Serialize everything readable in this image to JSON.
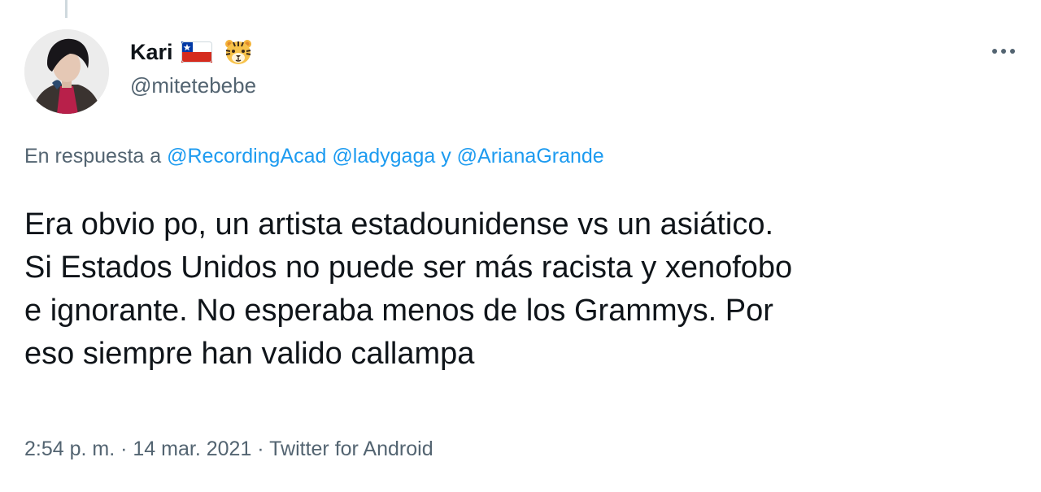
{
  "author": {
    "display_name": "Kari",
    "handle": "@mitetebebe",
    "emoji_icons": [
      "chile-flag-icon",
      "tiger-face-icon"
    ]
  },
  "menu": {
    "more_icon": "more-dots-icon"
  },
  "reply": {
    "prefix": "En respuesta a",
    "mention_1": "@RecordingAcad",
    "mention_2": "@ladygaga",
    "conjunction": "y",
    "mention_3": "@ArianaGrande"
  },
  "tweet": {
    "lines": [
      "Era obvio po, un artista estadounidense vs un asiático.",
      "Si Estados Unidos no puede ser más racista y xenofobo",
      "e ignorante. No esperaba menos de los Grammys. Por",
      "eso siempre han valido callampa"
    ]
  },
  "meta": {
    "time": "2:54 p. m.",
    "separator": "·",
    "date": "14 mar. 2021",
    "source": "Twitter for Android"
  },
  "colors": {
    "text": "#0f1419",
    "secondary": "#536471",
    "link": "#1d9bf0"
  }
}
